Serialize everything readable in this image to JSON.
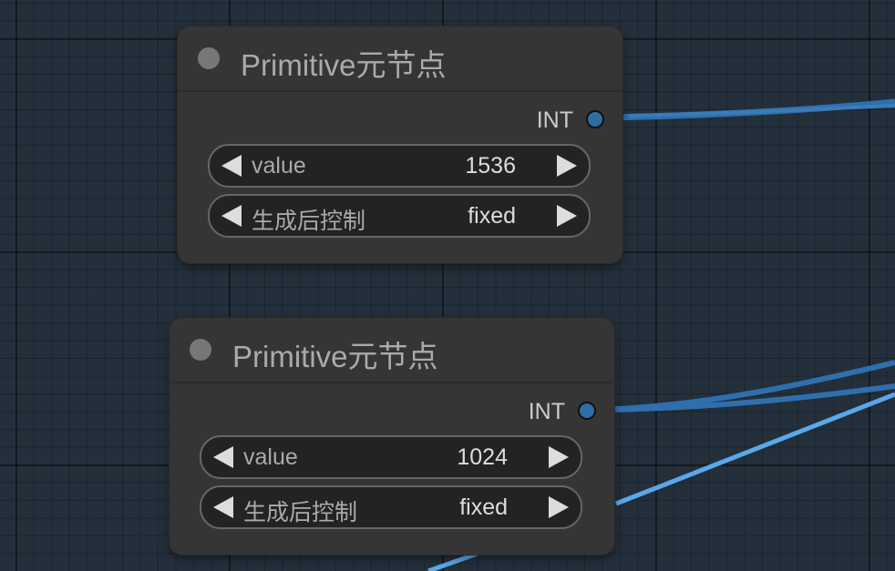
{
  "nodes": [
    {
      "title": "Primitive元节点",
      "output": {
        "label": "INT"
      },
      "widgets": [
        {
          "label": "value",
          "value": "1536"
        },
        {
          "label": "生成后控制",
          "value": "fixed"
        }
      ]
    },
    {
      "title": "Primitive元节点",
      "output": {
        "label": "INT"
      },
      "widgets": [
        {
          "label": "value",
          "value": "1024"
        },
        {
          "label": "生成后控制",
          "value": "fixed"
        }
      ]
    }
  ],
  "colors": {
    "link_int": "#2f6fad",
    "link_light": "#5aa7ea",
    "canvas": "#232f3a",
    "node_bg": "#353535"
  }
}
